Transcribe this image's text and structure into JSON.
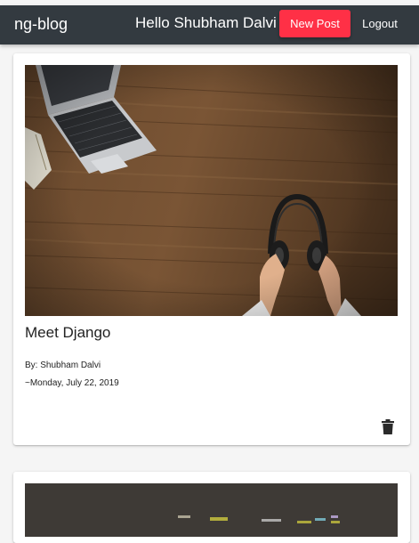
{
  "header": {
    "brand": "ng-blog",
    "greeting": "Hello Shubham Dalvi",
    "new_post_label": "New Post",
    "logout_label": "Logout"
  },
  "posts": [
    {
      "title": "Meet Django",
      "author": "By: Shubham Dalvi",
      "date": "~Monday, July 22, 2019",
      "image": "desk-laptop-headphones-photo"
    },
    {
      "image": "word-cloud-photo"
    }
  ],
  "icons": {
    "delete": "trash-icon"
  },
  "colors": {
    "navbar": "#333a40",
    "accent": "#ff3046",
    "background": "#f5f5f5"
  }
}
